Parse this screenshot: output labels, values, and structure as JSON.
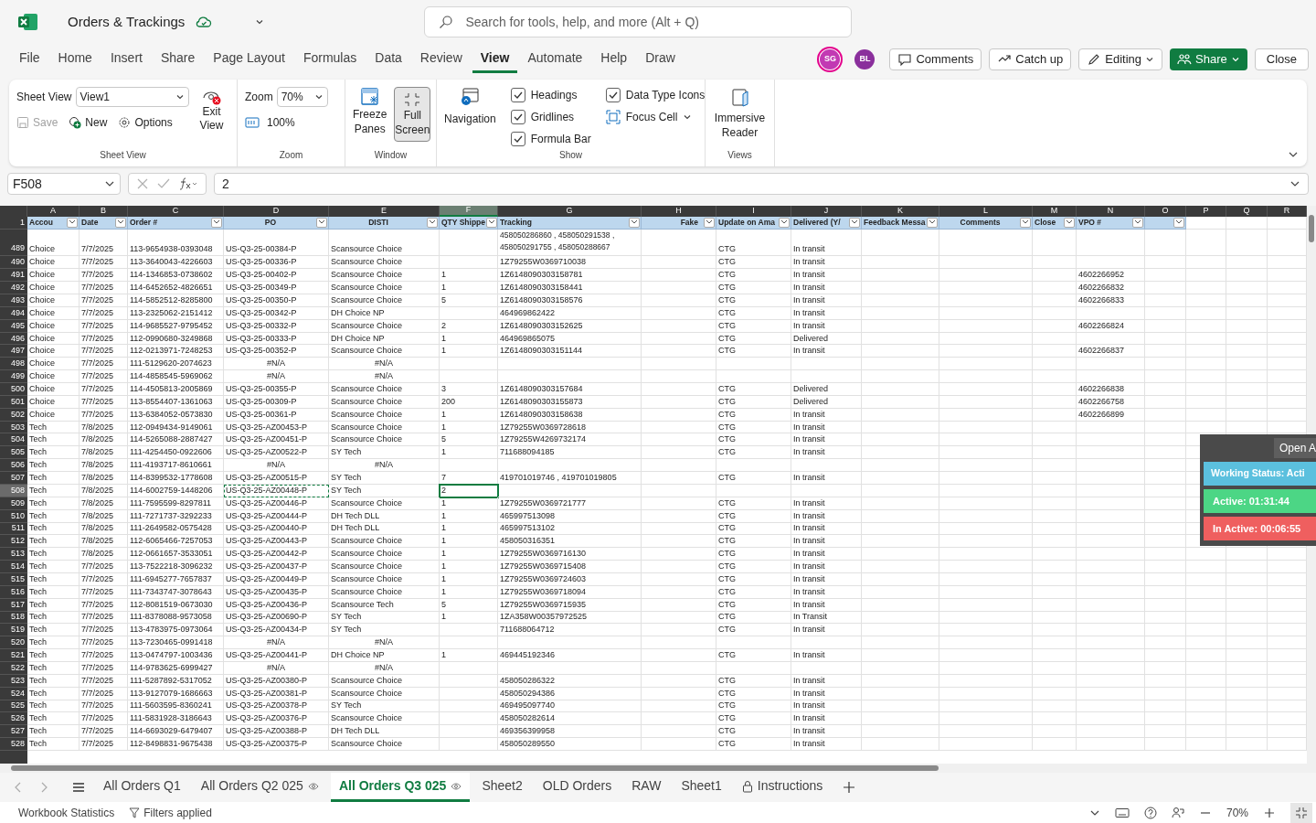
{
  "app": {
    "title": "Orders & Trackings",
    "search_placeholder": "Search for tools, help, and more (Alt + Q)"
  },
  "menu_tabs": [
    {
      "label": "File",
      "selected": false
    },
    {
      "label": "Home",
      "selected": false
    },
    {
      "label": "Insert",
      "selected": false
    },
    {
      "label": "Share",
      "selected": false
    },
    {
      "label": "Page Layout",
      "selected": false
    },
    {
      "label": "Formulas",
      "selected": false
    },
    {
      "label": "Data",
      "selected": false
    },
    {
      "label": "Review",
      "selected": false
    },
    {
      "label": "View",
      "selected": true
    },
    {
      "label": "Automate",
      "selected": false
    },
    {
      "label": "Help",
      "selected": false
    },
    {
      "label": "Draw",
      "selected": false
    }
  ],
  "avatars": [
    {
      "initials": "SG",
      "color": "#c239b3",
      "ring": true
    },
    {
      "initials": "BL",
      "color": "#8a2f9c",
      "ring": false
    }
  ],
  "header_buttons": [
    {
      "kind": "comments",
      "label": "Comments"
    },
    {
      "kind": "catchup",
      "label": "Catch up"
    },
    {
      "kind": "editing",
      "label": "Editing"
    },
    {
      "kind": "share",
      "label": "Share"
    },
    {
      "kind": "close",
      "label": "Close"
    }
  ],
  "ribbon": {
    "sheet_view": {
      "label": "Sheet View",
      "view": "View1",
      "save": {
        "label": "Save",
        "disabled": true
      },
      "new": "New",
      "options": "Options",
      "exit": "Exit View",
      "caption": "Sheet View"
    },
    "zoom": {
      "label": "Zoom",
      "value": "70%",
      "reset": "100%",
      "caption": "Zoom"
    },
    "window": {
      "freeze": "Freeze Panes",
      "full_screen": {
        "label": "Full Screen",
        "selected": true
      },
      "caption": "Window"
    },
    "show": {
      "navigation": "Navigation",
      "checkboxes": [
        {
          "label": "Headings",
          "checked": true
        },
        {
          "label": "Gridlines",
          "checked": true
        },
        {
          "label": "Formula Bar",
          "checked": true
        },
        {
          "label": "Data Type Icons",
          "checked": true
        }
      ],
      "focus_cell": "Focus Cell",
      "caption": "Show"
    },
    "views": {
      "immersive": "Immersive Reader",
      "caption": "Views"
    }
  },
  "formula_bar": {
    "name_box": "F508",
    "formula": "2"
  },
  "grid": {
    "columns": [
      {
        "letter": "A",
        "selected": false
      },
      {
        "letter": "B",
        "selected": false
      },
      {
        "letter": "C",
        "selected": false
      },
      {
        "letter": "D",
        "selected": false
      },
      {
        "letter": "E",
        "selected": false
      },
      {
        "letter": "F",
        "selected": true
      },
      {
        "letter": "G",
        "selected": false
      },
      {
        "letter": "H",
        "selected": false
      },
      {
        "letter": "I",
        "selected": false
      },
      {
        "letter": "J",
        "selected": false
      },
      {
        "letter": "K",
        "selected": false
      },
      {
        "letter": "L",
        "selected": false
      },
      {
        "letter": "M",
        "selected": false
      },
      {
        "letter": "N",
        "selected": false
      },
      {
        "letter": "O",
        "selected": false
      },
      {
        "letter": "P",
        "selected": false
      },
      {
        "letter": "Q",
        "selected": false
      },
      {
        "letter": "R",
        "selected": false
      }
    ],
    "header_row": {
      "num": "1",
      "cells": {
        "A": "Accou",
        "B": "Date",
        "C": "Order #",
        "D": "PO",
        "E": "DISTI",
        "F": "QTY Shippe",
        "G": "Tracking",
        "H": "Fake",
        "I": "Update on Ama",
        "J": "Delivered (Y/",
        "K": "Feedback Messa",
        "L": "Comments",
        "M": "Close",
        "N": "VPO #"
      }
    },
    "rows": [
      {
        "num": "489",
        "selected": false,
        "kind": "tall",
        "cells": {
          "A": "Choice",
          "B": "7/7/2025",
          "C": "113-9654938-0393048",
          "D": "US-Q3-25-00384-P",
          "E": "Scansource Choice",
          "G": "458050286860 , 458050291538 , 458050291755 , 458050288667",
          "I": "CTG",
          "J": "In transit"
        }
      },
      {
        "num": "490",
        "selected": false,
        "kind": "normal",
        "cells": {
          "A": "Choice",
          "B": "7/7/2025",
          "C": "113-3640043-4226603",
          "D": "US-Q3-25-00336-P",
          "E": "Scansource Choice",
          "G": "1Z79255W0369710038",
          "I": "CTG",
          "J": "In transit"
        }
      },
      {
        "num": "491",
        "selected": false,
        "kind": "normal",
        "cells": {
          "A": "Choice",
          "B": "7/7/2025",
          "C": "114-1346853-0738602",
          "D": "US-Q3-25-00402-P",
          "E": "Scansource Choice",
          "F": "1",
          "G": "1Z6148090303158781",
          "I": "CTG",
          "J": "In transit",
          "N": "4602266952"
        }
      },
      {
        "num": "492",
        "selected": false,
        "kind": "normal",
        "cells": {
          "A": "Choice",
          "B": "7/7/2025",
          "C": "114-6452652-4826651",
          "D": "US-Q3-25-00349-P",
          "E": "Scansource Choice",
          "F": "1",
          "G": "1Z6148090303158441",
          "I": "CTG",
          "J": "In transit",
          "N": "4602266832"
        }
      },
      {
        "num": "493",
        "selected": false,
        "kind": "normal",
        "cells": {
          "A": "Choice",
          "B": "7/7/2025",
          "C": "114-5852512-8285800",
          "D": "US-Q3-25-00350-P",
          "E": "Scansource Choice",
          "F": "5",
          "G": "1Z6148090303158576",
          "I": "CTG",
          "J": "In transit",
          "N": "4602266833"
        }
      },
      {
        "num": "494",
        "selected": false,
        "kind": "normal",
        "cells": {
          "A": "Choice",
          "B": "7/7/2025",
          "C": "113-2325062-2151412",
          "D": "US-Q3-25-00342-P",
          "E": "DH Choice NP",
          "G": "464969862422",
          "I": "CTG",
          "J": "In transit"
        }
      },
      {
        "num": "495",
        "selected": false,
        "kind": "normal",
        "cells": {
          "A": "Choice",
          "B": "7/7/2025",
          "C": "114-9685527-9795452",
          "D": "US-Q3-25-00332-P",
          "E": "Scansource Choice",
          "F": "2",
          "G": "1Z6148090303152625",
          "I": "CTG",
          "J": "In transit",
          "N": "4602266824"
        }
      },
      {
        "num": "496",
        "selected": false,
        "kind": "normal",
        "cells": {
          "A": "Choice",
          "B": "7/7/2025",
          "C": "112-0990680-3249868",
          "D": "US-Q3-25-00333-P",
          "E": "DH Choice NP",
          "F": "1",
          "G": "464969865075",
          "I": "CTG",
          "J": "Delivered"
        }
      },
      {
        "num": "497",
        "selected": false,
        "kind": "normal",
        "cells": {
          "A": "Choice",
          "B": "7/7/2025",
          "C": "112-0213971-7248253",
          "D": "US-Q3-25-00352-P",
          "E": "Scansource Choice",
          "F": "1",
          "G": "1Z6148090303151144",
          "I": "CTG",
          "J": "In transit",
          "N": "4602266837"
        }
      },
      {
        "num": "498",
        "selected": false,
        "kind": "error",
        "cells": {
          "A": "Choice",
          "B": "7/7/2025",
          "C": "111-5129620-2074623",
          "D": "#N/A",
          "E": "#N/A"
        }
      },
      {
        "num": "499",
        "selected": false,
        "kind": "error",
        "cells": {
          "A": "Choice",
          "B": "7/7/2025",
          "C": "114-4858545-5969062",
          "D": "#N/A",
          "E": "#N/A"
        }
      },
      {
        "num": "500",
        "selected": false,
        "kind": "normal",
        "cells": {
          "A": "Choice",
          "B": "7/7/2025",
          "C": "114-4505813-2005869",
          "D": "US-Q3-25-00355-P",
          "E": "Scansource Choice",
          "F": "3",
          "G": "1Z6148090303157684",
          "I": "CTG",
          "J": "Delivered",
          "N": "4602266838"
        }
      },
      {
        "num": "501",
        "selected": false,
        "kind": "normal",
        "cells": {
          "A": "Choice",
          "B": "7/7/2025",
          "C": "113-8554407-1361063",
          "D": "US-Q3-25-00309-P",
          "E": "Scansource Choice",
          "F": "200",
          "G": "1Z6148090303155873",
          "I": "CTG",
          "J": "Delivered",
          "N": "4602266758"
        }
      },
      {
        "num": "502",
        "selected": false,
        "kind": "normal",
        "cells": {
          "A": "Choice",
          "B": "7/7/2025",
          "C": "113-6384052-0573830",
          "D": "US-Q3-25-00361-P",
          "E": "Scansource Choice",
          "F": "1",
          "G": "1Z6148090303158638",
          "I": "CTG",
          "J": "In transit",
          "N": "4602266899"
        }
      },
      {
        "num": "503",
        "selected": false,
        "kind": "normal",
        "cells": {
          "A": "Tech",
          "B": "7/8/2025",
          "C": "112-0949434-9149061",
          "D": "US-Q3-25-AZ00453-P",
          "E": "Scansource Choice",
          "F": "1",
          "G": "1Z79255W0369728618",
          "I": "CTG",
          "J": "In transit"
        }
      },
      {
        "num": "504",
        "selected": false,
        "kind": "normal",
        "cells": {
          "A": "Tech",
          "B": "7/8/2025",
          "C": "114-5265088-2887427",
          "D": "US-Q3-25-AZ00451-P",
          "E": "Scansource Choice",
          "F": "5",
          "G": "1Z79255W4269732174",
          "I": "CTG",
          "J": "In transit"
        }
      },
      {
        "num": "505",
        "selected": false,
        "kind": "normal",
        "cells": {
          "A": "Tech",
          "B": "7/8/2025",
          "C": "111-4254450-0922606",
          "D": "US-Q3-25-AZ00522-P",
          "E": "SY Tech",
          "F": "1",
          "G": "711688094185",
          "I": "CTG",
          "J": "In transit"
        }
      },
      {
        "num": "506",
        "selected": false,
        "kind": "error",
        "cells": {
          "A": "Tech",
          "B": "7/8/2025",
          "C": "111-4193717-8610661",
          "D": "#N/A",
          "E": "#N/A"
        }
      },
      {
        "num": "507",
        "selected": false,
        "kind": "normal",
        "cells": {
          "A": "Tech",
          "B": "7/8/2025",
          "C": "114-8399532-1778608",
          "D": "US-Q3-25-AZ00515-P",
          "E": "SY Tech",
          "F": "7",
          "G": "419701019746 , 419701019805",
          "I": "CTG",
          "J": "In transit"
        }
      },
      {
        "num": "508",
        "selected": true,
        "kind": "normal",
        "cells": {
          "A": "Tech",
          "B": "7/8/2025",
          "C": "114-6002759-1448206",
          "D": {
            "text": "US-Q3-25-AZ00448-P",
            "copied": true
          },
          "E": "SY Tech",
          "F": "2"
        }
      },
      {
        "num": "509",
        "selected": false,
        "kind": "normal",
        "cells": {
          "A": "Tech",
          "B": "7/8/2025",
          "C": "111-7595599-8297811",
          "D": "US-Q3-25-AZ00446-P",
          "E": "Scansource Choice",
          "F": "1",
          "G": "1Z79255W0369721777",
          "I": "CTG",
          "J": "In transit"
        }
      },
      {
        "num": "510",
        "selected": false,
        "kind": "normal",
        "cells": {
          "A": "Tech",
          "B": "7/8/2025",
          "C": "111-7271737-3292233",
          "D": "US-Q3-25-AZ00444-P",
          "E": "DH Tech DLL",
          "F": "1",
          "G": "465997513098",
          "I": "CTG",
          "J": "In transit"
        }
      },
      {
        "num": "511",
        "selected": false,
        "kind": "normal",
        "cells": {
          "A": "Tech",
          "B": "7/8/2025",
          "C": "111-2649582-0575428",
          "D": "US-Q3-25-AZ00440-P",
          "E": "DH Tech DLL",
          "F": "1",
          "G": "465997513102",
          "I": "CTG",
          "J": "In transit"
        }
      },
      {
        "num": "512",
        "selected": false,
        "kind": "normal",
        "cells": {
          "A": "Tech",
          "B": "7/8/2025",
          "C": "112-6065466-7257053",
          "D": "US-Q3-25-AZ00443-P",
          "E": "Scansource Choice",
          "F": "1",
          "G": "458050316351",
          "I": "CTG",
          "J": "In transit"
        }
      },
      {
        "num": "513",
        "selected": false,
        "kind": "normal",
        "cells": {
          "A": "Tech",
          "B": "7/8/2025",
          "C": "112-0661657-3533051",
          "D": "US-Q3-25-AZ00442-P",
          "E": "Scansource Choice",
          "F": "1",
          "G": "1Z79255W0369716130",
          "I": "CTG",
          "J": "In transit"
        }
      },
      {
        "num": "514",
        "selected": false,
        "kind": "normal",
        "cells": {
          "A": "Tech",
          "B": "7/7/2025",
          "C": "113-7522218-3096232",
          "D": "US-Q3-25-AZ00437-P",
          "E": "Scansource Choice",
          "F": "1",
          "G": "1Z79255W0369715408",
          "I": "CTG",
          "J": "In transit"
        }
      },
      {
        "num": "515",
        "selected": false,
        "kind": "normal",
        "cells": {
          "A": "Tech",
          "B": "7/7/2025",
          "C": "111-6945277-7657837",
          "D": "US-Q3-25-AZ00449-P",
          "E": "Scansource Choice",
          "F": "1",
          "G": "1Z79255W0369724603",
          "I": "CTG",
          "J": "In transit"
        }
      },
      {
        "num": "516",
        "selected": false,
        "kind": "normal",
        "cells": {
          "A": "Tech",
          "B": "7/7/2025",
          "C": "111-7343747-3078643",
          "D": "US-Q3-25-AZ00435-P",
          "E": "Scansource Choice",
          "F": "1",
          "G": "1Z79255W0369718094",
          "I": "CTG",
          "J": "In transit"
        }
      },
      {
        "num": "517",
        "selected": false,
        "kind": "normal",
        "cells": {
          "A": "Tech",
          "B": "7/7/2025",
          "C": "112-8081519-0673030",
          "D": "US-Q3-25-AZ00436-P",
          "E": "Scansource Tech",
          "F": "5",
          "G": "1Z79255W0369715935",
          "I": "CTG",
          "J": "In transit"
        }
      },
      {
        "num": "518",
        "selected": false,
        "kind": "normal",
        "cells": {
          "A": "Tech",
          "B": "7/7/2025",
          "C": "111-8378088-9573058",
          "D": "US-Q3-25-AZ00690-P",
          "E": "SY Tech",
          "F": "1",
          "G": "1ZA358W00357972525",
          "I": "CTG",
          "J": "In Transit"
        }
      },
      {
        "num": "519",
        "selected": false,
        "kind": "normal",
        "cells": {
          "A": "Tech",
          "B": "7/7/2025",
          "C": "113-4783975-0973064",
          "D": "US-Q3-25-AZ00434-P",
          "E": "SY Tech",
          "G": "711688064712",
          "I": "CTG",
          "J": "In transit"
        }
      },
      {
        "num": "520",
        "selected": false,
        "kind": "error",
        "cells": {
          "A": "Tech",
          "B": "7/7/2025",
          "C": "113-7230465-0991418",
          "D": "#N/A",
          "E": "#N/A"
        }
      },
      {
        "num": "521",
        "selected": false,
        "kind": "normal",
        "cells": {
          "A": "Tech",
          "B": "7/7/2025",
          "C": "113-0474797-1003436",
          "D": "US-Q3-25-AZ00441-P",
          "E": "DH Choice NP",
          "F": "1",
          "G": "469445192346",
          "I": "CTG",
          "J": "In transit"
        }
      },
      {
        "num": "522",
        "selected": false,
        "kind": "error",
        "cells": {
          "A": "Tech",
          "B": "7/7/2025",
          "C": "114-9783625-6999427",
          "D": "#N/A",
          "E": "#N/A"
        }
      },
      {
        "num": "523",
        "selected": false,
        "kind": "normal",
        "cells": {
          "A": "Tech",
          "B": "7/7/2025",
          "C": "111-5287892-5317052",
          "D": "US-Q3-25-AZ00380-P",
          "E": "Scansource Choice",
          "G": "458050286322",
          "I": "CTG",
          "J": "In transit"
        }
      },
      {
        "num": "524",
        "selected": false,
        "kind": "normal",
        "cells": {
          "A": "Tech",
          "B": "7/7/2025",
          "C": "113-9127079-1686663",
          "D": "US-Q3-25-AZ00381-P",
          "E": "Scansource Choice",
          "G": "458050294386",
          "I": "CTG",
          "J": "In transit"
        }
      },
      {
        "num": "525",
        "selected": false,
        "kind": "normal",
        "cells": {
          "A": "Tech",
          "B": "7/7/2025",
          "C": "111-5603595-8360241",
          "D": "US-Q3-25-AZ00378-P",
          "E": "SY Tech",
          "G": "469495097740",
          "I": "CTG",
          "J": "In transit"
        }
      },
      {
        "num": "526",
        "selected": false,
        "kind": "normal",
        "cells": {
          "A": "Tech",
          "B": "7/7/2025",
          "C": "111-5831928-3186643",
          "D": "US-Q3-25-AZ00376-P",
          "E": "Scansource Choice",
          "G": "458050282614",
          "I": "CTG",
          "J": "In transit"
        }
      },
      {
        "num": "527",
        "selected": false,
        "kind": "normal",
        "cells": {
          "A": "Tech",
          "B": "7/7/2025",
          "C": "114-6693029-6479407",
          "D": "US-Q3-25-AZ00388-P",
          "E": "DH Tech DLL",
          "G": "469356399958",
          "I": "CTG",
          "J": "In transit"
        }
      },
      {
        "num": "528",
        "selected": false,
        "kind": "normal",
        "cells": {
          "A": "Tech",
          "B": "7/7/2025",
          "C": "112-8498831-9675438",
          "D": "US-Q3-25-AZ00375-P",
          "E": "Scansource Choice",
          "G": "458050289550",
          "I": "CTG",
          "J": "In transit"
        }
      }
    ]
  },
  "timer_widget": {
    "button": "Open A",
    "status": "Working Status: Acti",
    "active": "Active: 01:31:44",
    "inactive": "In Active: 00:06:55"
  },
  "sheet_tabs": [
    {
      "label": "All Orders Q1",
      "kind": "plain",
      "selected": false
    },
    {
      "label": "All Orders Q2 025",
      "kind": "shared",
      "selected": false
    },
    {
      "label": "All Orders Q3 025",
      "kind": "shared",
      "selected": true
    },
    {
      "label": "Sheet2",
      "kind": "plain",
      "selected": false
    },
    {
      "label": "OLD Orders",
      "kind": "plain",
      "selected": false
    },
    {
      "label": "RAW",
      "kind": "plain",
      "selected": false
    },
    {
      "label": "Sheet1",
      "kind": "plain",
      "selected": false
    },
    {
      "label": "Instructions",
      "kind": "locked",
      "selected": false
    }
  ],
  "status_bar": {
    "statistics": "Workbook Statistics",
    "filters": "Filters applied",
    "zoom": "70%"
  }
}
